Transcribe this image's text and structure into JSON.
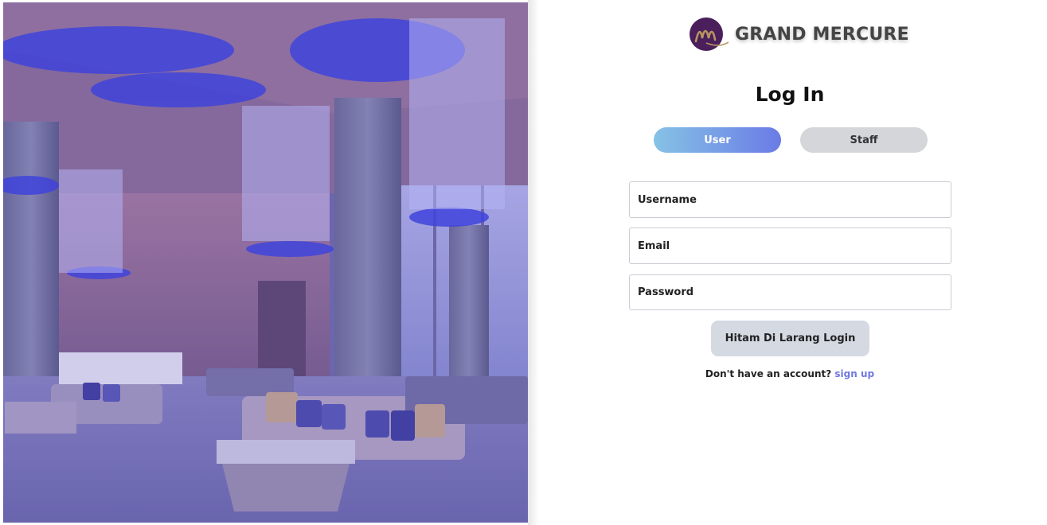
{
  "brand": {
    "name": "GRAND MERCURE",
    "logo_letter": "m",
    "logo_color": "#4a1f5c",
    "logo_accent": "#b89560"
  },
  "hero": {
    "description_icon": "hotel-lobby-photo"
  },
  "login": {
    "title": "Log In",
    "tabs": [
      {
        "label": "User",
        "active": true
      },
      {
        "label": "Staff",
        "active": false
      }
    ],
    "fields": {
      "username_placeholder": "Username",
      "email_placeholder": "Email",
      "password_placeholder": "Password"
    },
    "submit_label": "Hitam Di Larang Login",
    "signup_prompt": "Don't have an account?",
    "signup_link": "sign up"
  },
  "colors": {
    "accent_gradient_start": "#86c2e5",
    "accent_gradient_end": "#6a7be6",
    "link": "#6f78e0",
    "inactive_tab": "#d4d6da",
    "button": "#d4d9e2"
  }
}
